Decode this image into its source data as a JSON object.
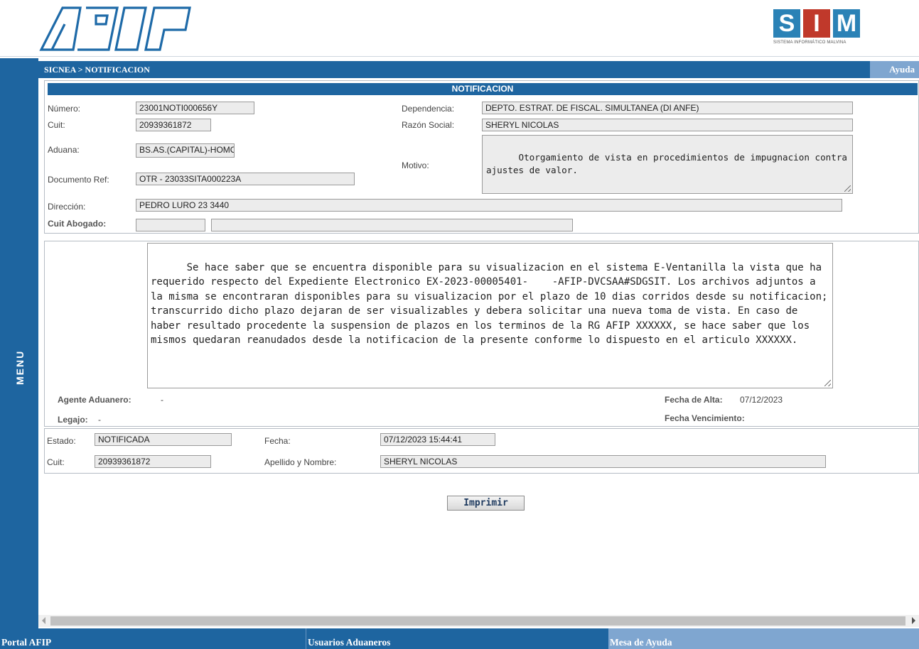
{
  "header": {
    "brand_left": "AFIP",
    "brand_right": {
      "letters": [
        "S",
        "I",
        "M"
      ],
      "caption": "SISTEMA INFORMÁTICO MALVINA"
    }
  },
  "side_menu": {
    "label": "MENU"
  },
  "breadcrumb": {
    "text": "SICNEA > NOTIFICACION",
    "help": "Ayuda"
  },
  "notification": {
    "title": "NOTIFICACION",
    "numero_label": "Número:",
    "numero": "23001NOTI000656Y",
    "cuit_label": "Cuit:",
    "cuit": "20939361872",
    "aduana_label": "Aduana:",
    "aduana": "BS.AS.(CAPITAL)-HOMO",
    "docref_label": "Documento Ref:",
    "docref": "OTR  -  23033SITA000223A",
    "direccion_label": "Dirección:",
    "direccion": "PEDRO LURO 23 3440",
    "abogado_label": "Cuit Abogado:",
    "abogado_cuit": "",
    "abogado_nombre": "",
    "dependencia_label": "Dependencia:",
    "dependencia": "DEPTO. ESTRAT. DE FISCAL. SIMULTANEA (DI ANFE)",
    "razon_label": "Razón Social:",
    "razon": "SHERYL NICOLAS",
    "motivo_label": "Motivo:",
    "motivo": "Otorgamiento de vista en procedimientos de impugnacion contra ajustes de valor."
  },
  "message": {
    "text": "Se hace saber que se encuentra disponible para su visualizacion en el sistema E-Ventanilla la vista que ha requerido respecto del Expediente Electronico EX-2023-00005401-    -AFIP-DVCSAA#SDGSIT. Los archivos adjuntos a la misma se encontraran disponibles para su visualizacion por el plazo de 10 dias corridos desde su notificacion; transcurrido dicho plazo dejaran de ser visualizables y debera solicitar una nueva toma de vista. En caso de haber resultado procedente la suspension de plazos en los terminos de la RG AFIP XXXXXX, se hace saber que los mismos quedaran reanudados desde la notificacion de la presente conforme lo dispuesto en el articulo XXXXXX.",
    "agente_label": "Agente Aduanero:",
    "agente": "-",
    "legajo_label": "Legajo:",
    "legajo": "-",
    "alta_label": "Fecha de Alta:",
    "alta": "07/12/2023",
    "venc_label": "Fecha Vencimiento:",
    "venc": ""
  },
  "status": {
    "estado_label": "Estado:",
    "estado": "NOTIFICADA",
    "fecha_label": "Fecha:",
    "fecha": "07/12/2023 15:44:41",
    "cuit_label": "Cuit:",
    "cuit": "20939361872",
    "nombre_label": "Apellido y Nombre:",
    "nombre": "SHERYL NICOLAS"
  },
  "actions": {
    "print": "Imprimir"
  },
  "footer": {
    "portal": "Portal AFIP",
    "usuarios": "Usuarios Aduaneros",
    "mesa": "Mesa de Ayuda"
  }
}
